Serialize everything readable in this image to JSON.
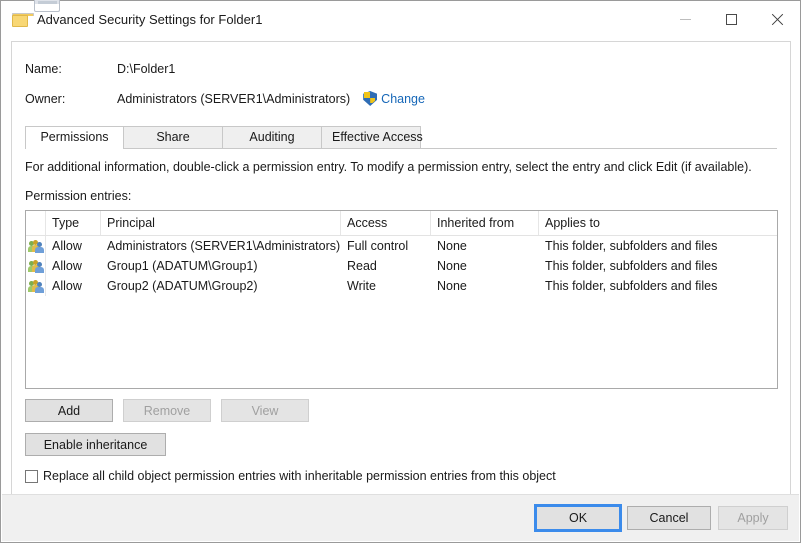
{
  "window": {
    "title": "Advanced Security Settings for Folder1",
    "folder_icon": "folder-icon",
    "controls": {
      "minimize": "minimize-icon",
      "maximize": "maximize-icon",
      "close": "close-icon"
    }
  },
  "header": {
    "name_label": "Name:",
    "name_value": "D:\\Folder1",
    "owner_label": "Owner:",
    "owner_value": "Administrators (SERVER1\\Administrators)",
    "change_link": "Change",
    "shield_icon": "uac-shield-icon"
  },
  "tabs": [
    {
      "label": "Permissions",
      "active": true
    },
    {
      "label": "Share",
      "active": false
    },
    {
      "label": "Auditing",
      "active": false
    },
    {
      "label": "Effective Access",
      "active": false
    }
  ],
  "main": {
    "info_text": "For additional information, double-click a permission entry. To modify a permission entry, select the entry and click Edit (if available).",
    "entries_label": "Permission entries:"
  },
  "table": {
    "columns": [
      "",
      "Type",
      "Principal",
      "Access",
      "Inherited from",
      "Applies to"
    ],
    "rows": [
      {
        "icon": "users-group-icon",
        "type": "Allow",
        "principal": "Administrators (SERVER1\\Administrators)",
        "access": "Full control",
        "inherited_from": "None",
        "applies_to": "This folder, subfolders and files"
      },
      {
        "icon": "users-group-icon",
        "type": "Allow",
        "principal": "Group1 (ADATUM\\Group1)",
        "access": "Read",
        "inherited_from": "None",
        "applies_to": "This folder, subfolders and files"
      },
      {
        "icon": "users-group-icon",
        "type": "Allow",
        "principal": "Group2 (ADATUM\\Group2)",
        "access": "Write",
        "inherited_from": "None",
        "applies_to": "This folder, subfolders and files"
      }
    ]
  },
  "actions": {
    "add": "Add",
    "remove": "Remove",
    "view": "View",
    "enable_inheritance": "Enable inheritance",
    "replace_checkbox_label": "Replace all child object permission entries with inheritable permission entries from this object",
    "replace_checkbox_checked": false
  },
  "footer": {
    "ok": "OK",
    "cancel": "Cancel",
    "apply": "Apply"
  },
  "colors": {
    "link": "#1667b8",
    "focus": "#3b8beb",
    "disabled_text": "#a0a0a0"
  }
}
